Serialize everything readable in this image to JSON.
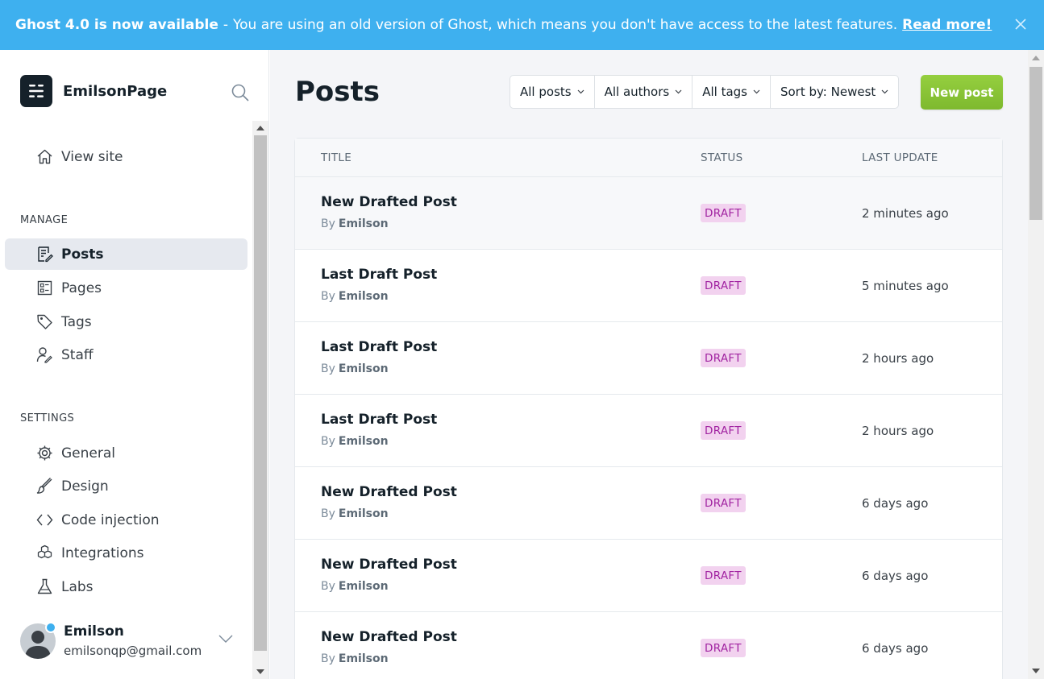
{
  "banner": {
    "headline": "Ghost 4.0 is now available",
    "separator": "-",
    "message": "You are using an old version of Ghost, which means you don't have access to the latest features.",
    "link": "Read more!"
  },
  "sidebar": {
    "brand": "EmilsonPage",
    "view_site": "View site",
    "manage_label": "MANAGE",
    "manage_items": [
      {
        "label": "Posts",
        "icon": "posts-icon",
        "active": true
      },
      {
        "label": "Pages",
        "icon": "pages-icon"
      },
      {
        "label": "Tags",
        "icon": "tag-icon"
      },
      {
        "label": "Staff",
        "icon": "staff-icon"
      }
    ],
    "settings_label": "SETTINGS",
    "settings_items": [
      {
        "label": "General",
        "icon": "gear-icon"
      },
      {
        "label": "Design",
        "icon": "brush-icon"
      },
      {
        "label": "Code injection",
        "icon": "code-icon"
      },
      {
        "label": "Integrations",
        "icon": "integrations-icon"
      },
      {
        "label": "Labs",
        "icon": "flask-icon"
      }
    ],
    "user": {
      "name": "Emilson",
      "email": "emilsonqp@gmail.com"
    }
  },
  "main": {
    "title": "Posts",
    "filters": [
      "All posts",
      "All authors",
      "All tags",
      "Sort by: Newest"
    ],
    "new_post": "New post",
    "columns": {
      "title": "TITLE",
      "status": "STATUS",
      "updated": "LAST UPDATE"
    },
    "by_label": "By",
    "posts": [
      {
        "title": "New Drafted Post",
        "author": "Emilson",
        "status": "DRAFT",
        "updated": "2 minutes ago"
      },
      {
        "title": "Last Draft Post",
        "author": "Emilson",
        "status": "DRAFT",
        "updated": "5 minutes ago"
      },
      {
        "title": "Last Draft Post",
        "author": "Emilson",
        "status": "DRAFT",
        "updated": "2 hours ago"
      },
      {
        "title": "Last Draft Post",
        "author": "Emilson",
        "status": "DRAFT",
        "updated": "2 hours ago"
      },
      {
        "title": "New Drafted Post",
        "author": "Emilson",
        "status": "DRAFT",
        "updated": "6 days ago"
      },
      {
        "title": "New Drafted Post",
        "author": "Emilson",
        "status": "DRAFT",
        "updated": "6 days ago"
      },
      {
        "title": "New Drafted Post",
        "author": "Emilson",
        "status": "DRAFT",
        "updated": "6 days ago"
      }
    ]
  },
  "colors": {
    "banner": "#3eb0ef",
    "new_post_button": "#8ac735",
    "draft_badge_bg": "#f2d2ef",
    "draft_badge_text": "#a123a1"
  }
}
